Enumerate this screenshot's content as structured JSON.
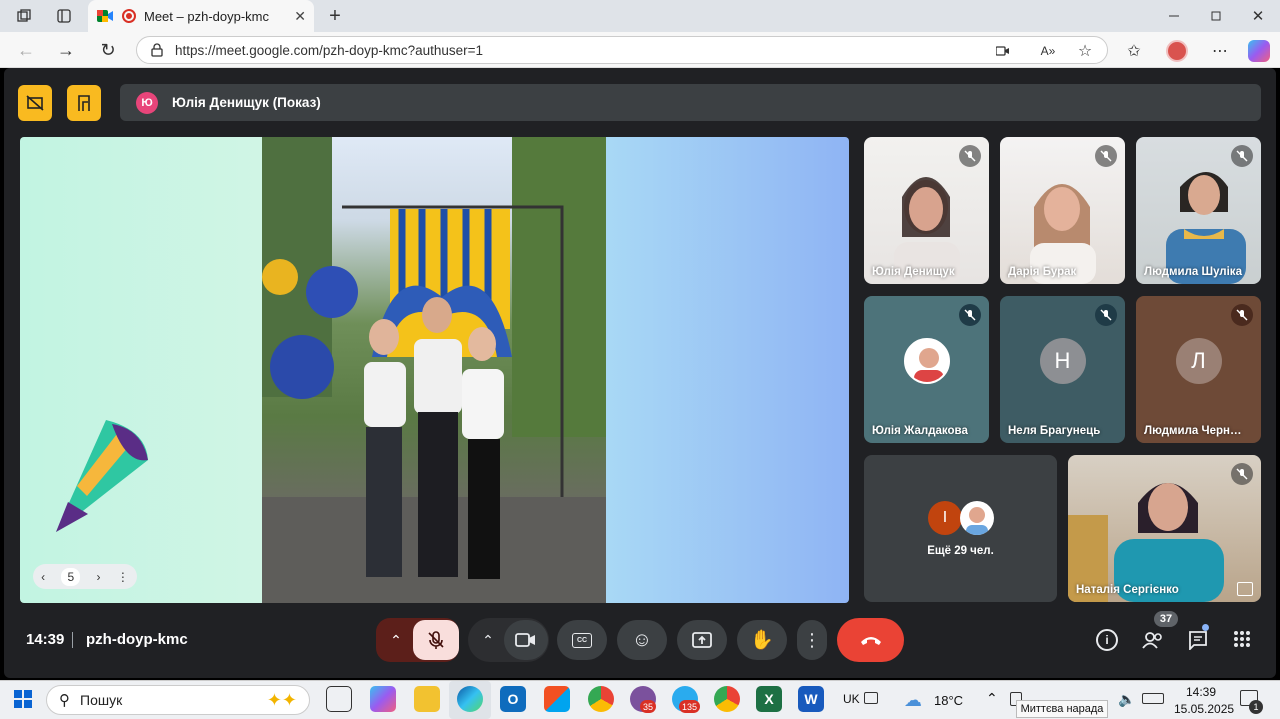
{
  "browser": {
    "tab_title": "Meet – pzh-doyp-kmc",
    "url": "https://meet.google.com/pzh-doyp-kmc?authuser=1"
  },
  "presenter": {
    "initial": "Ю",
    "label": "Юлія Денищук (Показ)"
  },
  "slide": {
    "page": "5"
  },
  "participants": [
    {
      "name": "Юлія Денищук"
    },
    {
      "name": "Дарія Бурак"
    },
    {
      "name": "Людмила Шуліка"
    },
    {
      "name": "Юлія Жалдакова"
    },
    {
      "name": "Неля Брагунець",
      "initial": "Н"
    },
    {
      "name": "Людмила Черн…",
      "initial": "Л"
    },
    {
      "name": "Наталія Сергієнко"
    }
  ],
  "others": {
    "initial": "І",
    "label": "Ещё 29 чел."
  },
  "bottom": {
    "time": "14:39",
    "code": "pzh-doyp-kmc",
    "people_count": "37"
  },
  "taskbar": {
    "search": "Пошук",
    "lang": "UK",
    "weather": "18°C",
    "time": "14:39",
    "date": "15.05.2025",
    "tooltip": "Миттєва нарада",
    "viber_badge": "35",
    "telegram_badge": "135",
    "notif": "1"
  },
  "colors": {
    "accent": "#f9ba20",
    "end_call": "#ea4335",
    "mic_off": "#f9dedc"
  }
}
